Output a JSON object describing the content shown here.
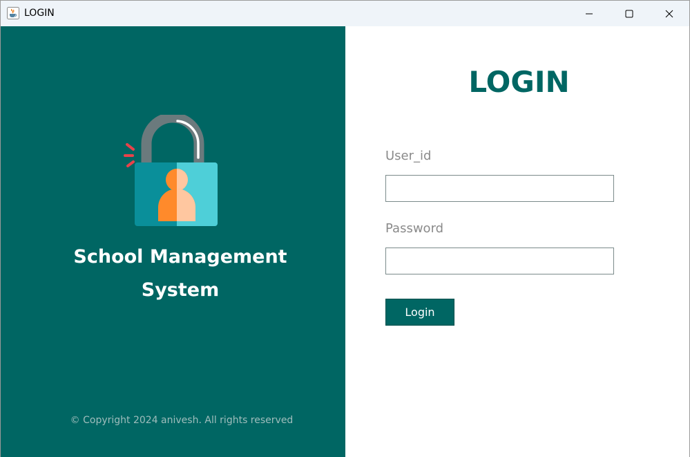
{
  "window": {
    "title": "LOGIN",
    "app_icon": "java-cup-icon",
    "controls": {
      "minimize": "minimize-icon",
      "maximize": "maximize-icon",
      "close": "close-icon"
    }
  },
  "brand": {
    "illustration": "padlock-user-icon",
    "title_line1": "School Management",
    "title_line2": "System",
    "copyright": "© Copyright 2024 anivesh. All rights reserved"
  },
  "login": {
    "heading": "LOGIN",
    "user_label": "User_id",
    "user_value": "",
    "user_placeholder": "",
    "password_label": "Password",
    "password_value": "",
    "password_placeholder": "",
    "button_label": "Login"
  },
  "colors": {
    "primary": "#006663",
    "panel_text": "#ffffff",
    "muted_text": "#8a8a8a",
    "copyright_text": "#9fbdbc",
    "lock_body_dark": "#0a8f9a",
    "lock_body_light": "#4ecfd8",
    "lock_shackle": "#6b7a7d",
    "user_figure": "#ff8a2b",
    "alert_marks": "#e8424a"
  }
}
